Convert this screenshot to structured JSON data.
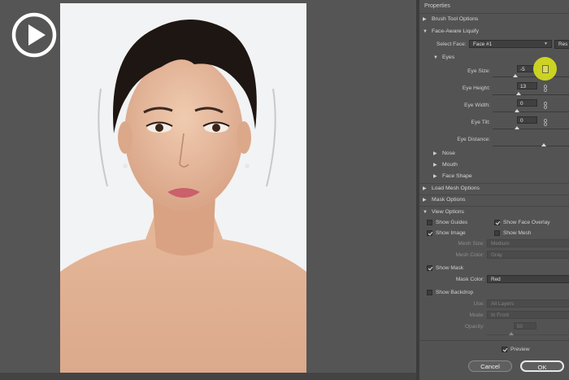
{
  "panel": {
    "title": "Properties",
    "brush_tool_options": "Brush Tool Options",
    "face_aware_liquify": "Face-Aware Liquify",
    "select_face_label": "Select Face:",
    "select_face_value": "Face #1",
    "reset_button": "Res",
    "eyes": {
      "title": "Eyes",
      "eye_size_label": "Eye Size:",
      "eye_size_value": "-5",
      "eye_height_label": "Eye Height:",
      "eye_height_value": "13",
      "eye_width_label": "Eye Width:",
      "eye_width_value": "0",
      "eye_tilt_label": "Eye Tilt:",
      "eye_tilt_value": "0",
      "eye_distance_label": "Eye Distance:"
    },
    "nose": "Nose",
    "mouth": "Mouth",
    "face_shape": "Face Shape",
    "load_mesh_options": "Load Mesh Options",
    "mask_options": "Mask Options",
    "view_options": {
      "title": "View Options",
      "show_guides": "Show Guides",
      "show_face_overlay": "Show Face Overlay",
      "show_image": "Show Image",
      "show_mesh": "Show Mesh",
      "mesh_size_label": "Mesh Size:",
      "mesh_size_value": "Medium",
      "mesh_color_label": "Mesh Color:",
      "mesh_color_value": "Gray",
      "show_mask": "Show Mask",
      "mask_color_label": "Mask Color:",
      "mask_color_value": "Red",
      "show_backdrop": "Show Backdrop",
      "use_label": "Use:",
      "use_value": "All Layers",
      "mode_label": "Mode:",
      "mode_value": "In Front",
      "opacity_label": "Opacity:",
      "opacity_value": "50"
    },
    "preview_label": "Preview",
    "cancel_button": "Cancel",
    "ok_button": "OK"
  },
  "states": {
    "show_guides": false,
    "show_face_overlay": true,
    "show_image": true,
    "show_mesh": false,
    "show_mask": true,
    "show_backdrop": false,
    "preview": true
  },
  "icons": {
    "play": "play-icon",
    "cursor": "pointer-cursor-icon",
    "link": "link-icon"
  },
  "colors": {
    "cursor_highlight": "#d7de1e",
    "panel_bg": "#535353",
    "canvas_bg": "#555555"
  }
}
